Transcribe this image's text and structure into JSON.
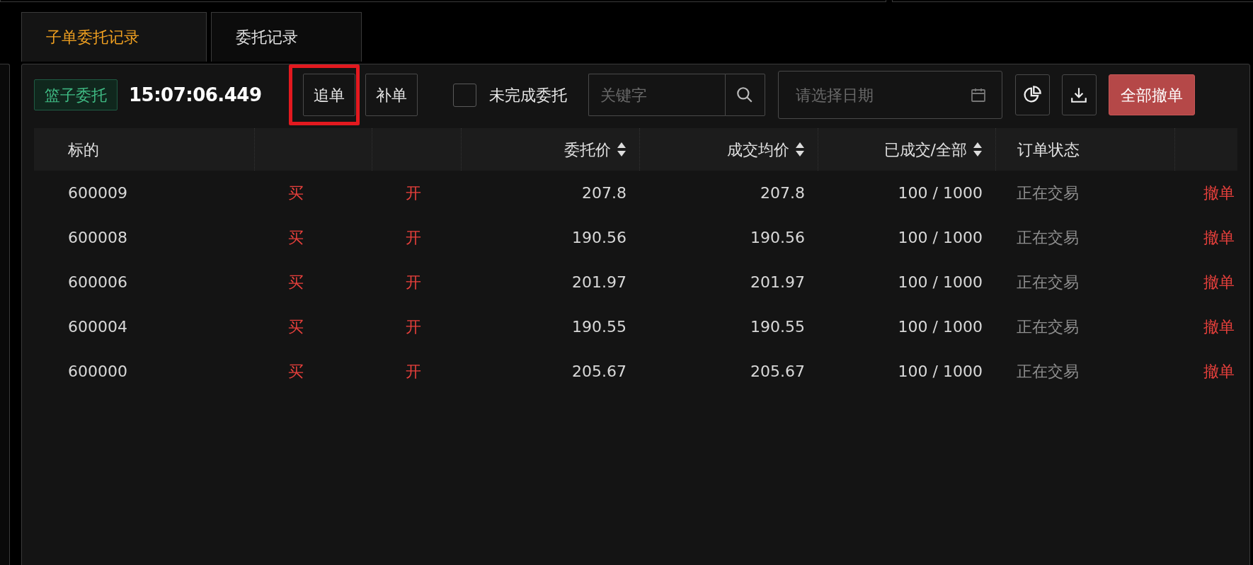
{
  "tabs": [
    {
      "label": "子单委托记录",
      "selected": true
    },
    {
      "label": "委托记录",
      "selected": false
    }
  ],
  "toolbar": {
    "tag": "篮子委托",
    "time": "15:07:06.449",
    "buttons": [
      {
        "label": "追单",
        "highlighted": true
      },
      {
        "label": "补单",
        "highlighted": false
      }
    ],
    "checkbox": {
      "label": "未完成委托",
      "checked": false
    },
    "search": {
      "placeholder": "关键字"
    },
    "date": {
      "placeholder": "请选择日期"
    },
    "cancel_all": "全部撤单"
  },
  "table": {
    "columns": [
      {
        "label": "标的",
        "sortable": false
      },
      {},
      {},
      {
        "label": "委托价",
        "sortable": true
      },
      {
        "label": "成交均价",
        "sortable": true
      },
      {
        "label": "已成交/全部",
        "sortable": true
      },
      {
        "label": "订单状态",
        "sortable": false
      },
      {}
    ],
    "rows": [
      {
        "cells": [
          "600009",
          "买",
          "开",
          "207.8",
          "207.8",
          "100 / 1000",
          "正在交易",
          "撤单"
        ]
      },
      {
        "cells": [
          "600008",
          "买",
          "开",
          "190.56",
          "190.56",
          "100 / 1000",
          "正在交易",
          "撤单"
        ]
      },
      {
        "cells": [
          "600006",
          "买",
          "开",
          "201.97",
          "201.97",
          "100 / 1000",
          "正在交易",
          "撤单"
        ]
      },
      {
        "cells": [
          "600004",
          "买",
          "开",
          "190.55",
          "190.55",
          "100 / 1000",
          "正在交易",
          "撤单"
        ]
      },
      {
        "cells": [
          "600000",
          "买",
          "开",
          "205.67",
          "205.67",
          "100 / 1000",
          "正在交易",
          "撤单"
        ]
      }
    ]
  }
}
